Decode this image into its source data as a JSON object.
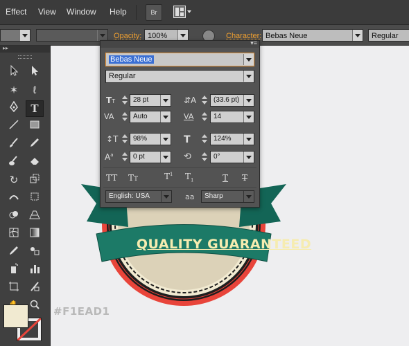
{
  "menubar": {
    "items": [
      "Effect",
      "View",
      "Window",
      "Help"
    ],
    "bridge_label": "Br"
  },
  "controlbar": {
    "opacity_label": "Opacity:",
    "opacity_value": "100%",
    "character_label": "Character:",
    "font_value": "Bebas Neue",
    "style_value": "Regular"
  },
  "character_panel": {
    "font_family": "Bebas Neue",
    "font_style": "Regular",
    "font_size": "28 pt",
    "leading": "(33.6 pt)",
    "kerning": "Auto",
    "tracking": "14",
    "vertical_scale": "98%",
    "horizontal_scale": "124%",
    "baseline_shift": "0 pt",
    "rotation": "0°",
    "language": "English: USA",
    "antialiasing": "Sharp",
    "aa_label": "aa"
  },
  "canvas": {
    "banner_text": "QUALITY GUARANTEED",
    "color_hex": "#F1EAD1"
  },
  "colors": {
    "fill": "#F1EAD1",
    "red_ring": "#e8443a",
    "ribbon": "#1c7a67",
    "badge_inner": "#dcd2b8",
    "banner_text": "#f6ecb0"
  }
}
